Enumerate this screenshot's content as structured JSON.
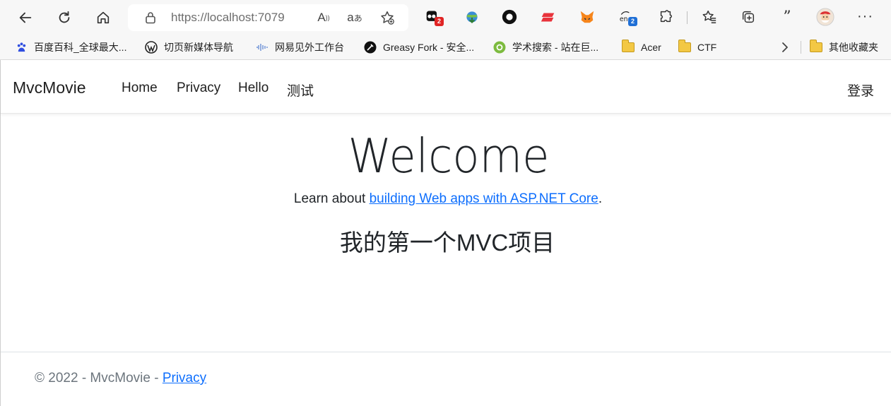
{
  "browser": {
    "address": "https://localhost:7079",
    "ext_badges": {
      "ext1": "2",
      "translate": "2"
    },
    "menu_label": "···"
  },
  "favorites": [
    {
      "label": "百度百科_全球最大...",
      "icon": "baidu-icon"
    },
    {
      "label": "切页新媒体导航",
      "icon": "wordpress-icon"
    },
    {
      "label": "网易见外工作台",
      "icon": "wave-icon"
    },
    {
      "label": "Greasy Fork - 安全...",
      "icon": "greasyfork-icon"
    },
    {
      "label": "学术搜索 - 站在巨...",
      "icon": "scholar-icon"
    },
    {
      "label": "Acer",
      "icon": "folder-icon"
    },
    {
      "label": "CTF",
      "icon": "folder-icon"
    },
    {
      "label": "其他收藏夹",
      "icon": "folder-icon"
    }
  ],
  "navbar": {
    "brand": "MvcMovie",
    "links": [
      "Home",
      "Privacy",
      "Hello",
      "测试"
    ],
    "login": "登录"
  },
  "main": {
    "title": "Welcome",
    "learn_prefix": "Learn about ",
    "learn_link": "building Web apps with ASP.NET Core",
    "learn_suffix": ".",
    "subtitle": "我的第一个MVC项目"
  },
  "footer": {
    "text": "© 2022 - MvcMovie - ",
    "link": "Privacy"
  },
  "colors": {
    "link": "#0d6efd",
    "footer_text": "#6c757d",
    "chrome_bg": "#f7f7f7"
  }
}
